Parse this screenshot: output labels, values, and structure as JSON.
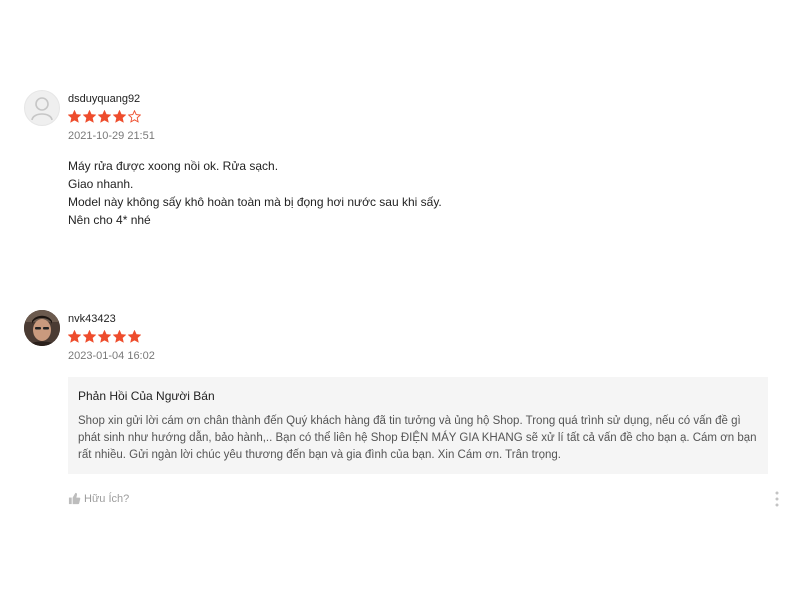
{
  "reviews": [
    {
      "username": "dsduyquang92",
      "rating": 4,
      "max_rating": 5,
      "time": "2021-10-29 21:51",
      "content": [
        "Máy rửa được xoong nồi ok. Rửa sạch.",
        "Giao nhanh.",
        "Model này không sấy khô hoàn toàn mà bị đọng hơi nước sau khi sấy.",
        "Nên cho 4* nhé"
      ],
      "avatar_icon": "default-user-avatar-icon"
    },
    {
      "username": "nvk43423",
      "rating": 5,
      "max_rating": 5,
      "time": "2023-01-04 16:02",
      "avatar_icon": "user-photo-avatar",
      "seller_reply": {
        "title": "Phản Hồi Của Người Bán",
        "text": "Shop xin gửi lời cám ơn chân thành đến Quý khách hàng đã tin tưởng và ủng hộ Shop. Trong quá trình sử dụng, nếu có vấn đề gì phát sinh như hướng dẫn, bảo hành,.. Bạn có thể liên hệ Shop ĐIỆN MÁY GIA KHANG sẽ xử lí tất cả vấn đề cho bạn ạ. Cám ơn bạn rất nhiều. Gửi ngàn lời chúc yêu thương đến bạn và gia đình của bạn. Xin Cám ơn. Trân trọng."
      },
      "helpful_label": "Hữu Ích?"
    }
  ],
  "colors": {
    "star": "#ee4d2d",
    "reply_bg": "#f5f5f5"
  }
}
